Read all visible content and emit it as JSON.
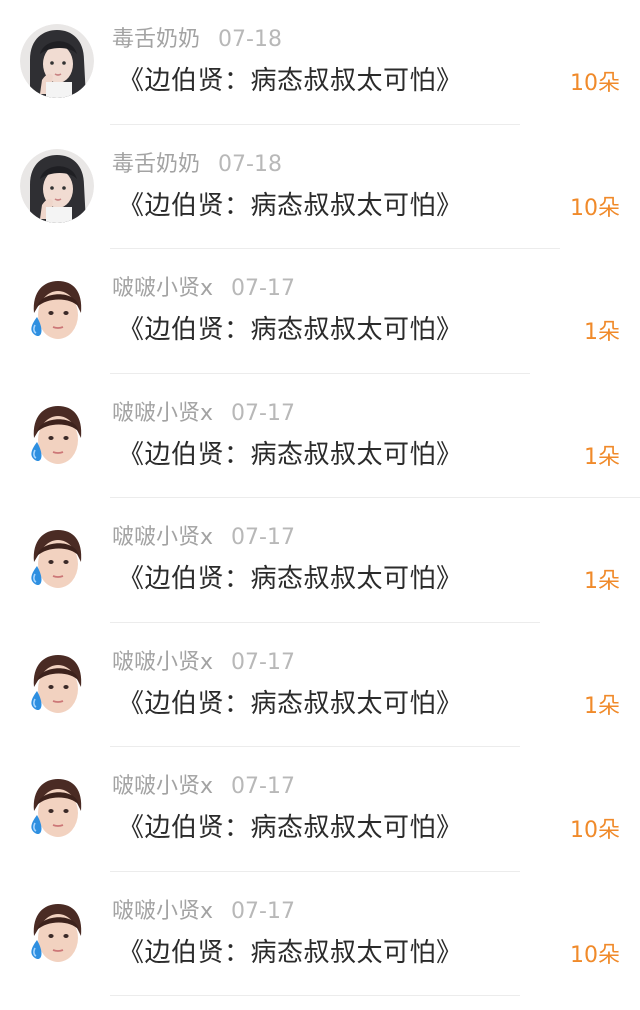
{
  "colors": {
    "accent": "#f08a2a",
    "username": "#a3a3a3",
    "date": "#b8b8b8",
    "title": "#2b2b2b",
    "divider": "#ececec"
  },
  "rows": [
    {
      "username": "毒舌奶奶",
      "date": "07-18",
      "title": "《边伯贤：病态叔叔太可怕》",
      "gift": "10朵",
      "avatar_icon": "girl-portrait-avatar"
    },
    {
      "username": "毒舌奶奶",
      "date": "07-18",
      "title": "《边伯贤：病态叔叔太可怕》",
      "gift": "10朵",
      "avatar_icon": "girl-portrait-avatar"
    },
    {
      "username": "啵啵小贤x",
      "date": "07-17",
      "title": "《边伯贤：病态叔叔太可怕》",
      "gift": "1朵",
      "avatar_icon": "sweat-face-avatar"
    },
    {
      "username": "啵啵小贤x",
      "date": "07-17",
      "title": "《边伯贤：病态叔叔太可怕》",
      "gift": "1朵",
      "avatar_icon": "sweat-face-avatar"
    },
    {
      "username": "啵啵小贤x",
      "date": "07-17",
      "title": "《边伯贤：病态叔叔太可怕》",
      "gift": "1朵",
      "avatar_icon": "sweat-face-avatar"
    },
    {
      "username": "啵啵小贤x",
      "date": "07-17",
      "title": "《边伯贤：病态叔叔太可怕》",
      "gift": "1朵",
      "avatar_icon": "sweat-face-avatar"
    },
    {
      "username": "啵啵小贤x",
      "date": "07-17",
      "title": "《边伯贤：病态叔叔太可怕》",
      "gift": "10朵",
      "avatar_icon": "sweat-face-avatar"
    },
    {
      "username": "啵啵小贤x",
      "date": "07-17",
      "title": "《边伯贤：病态叔叔太可怕》",
      "gift": "10朵",
      "avatar_icon": "sweat-face-avatar"
    }
  ]
}
